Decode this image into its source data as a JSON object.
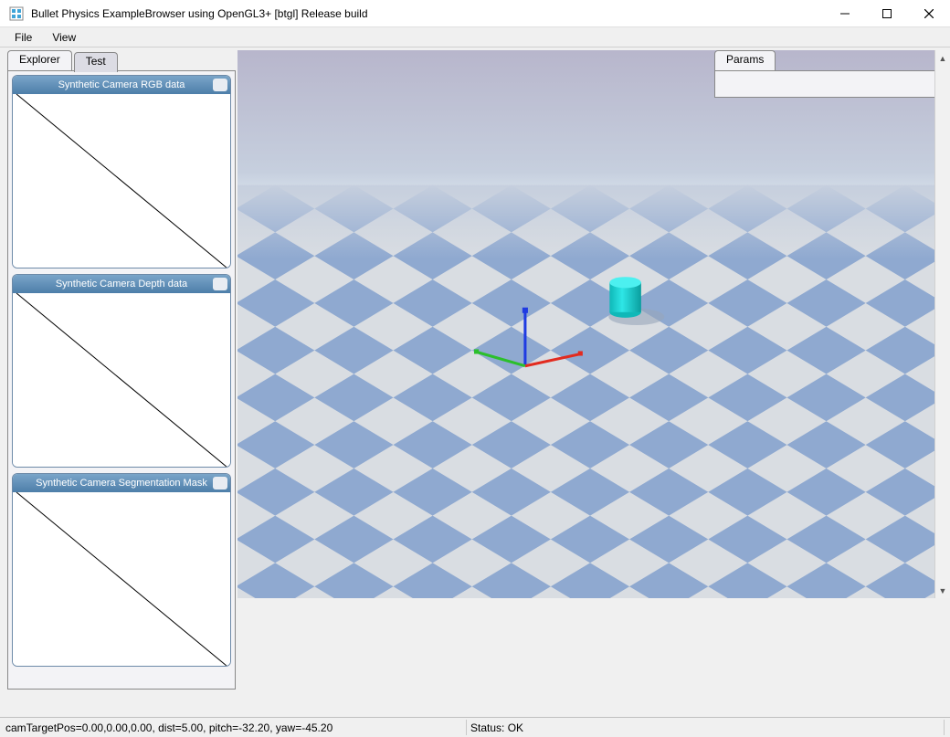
{
  "window": {
    "title": "Bullet Physics ExampleBrowser using OpenGL3+ [btgl] Release build"
  },
  "menu": {
    "file": "File",
    "view": "View"
  },
  "left": {
    "tabs": {
      "explorer": "Explorer",
      "test": "Test"
    },
    "cards": {
      "rgb": "Synthetic Camera RGB data",
      "depth": "Synthetic Camera Depth data",
      "seg": "Synthetic Camera Segmentation Mask"
    }
  },
  "right": {
    "tab": "Params"
  },
  "status": {
    "cam": "camTargetPos=0.00,0.00,0.00, dist=5.00, pitch=-32.20, yaw=-45.20",
    "ok": "Status: OK"
  },
  "scene": {
    "object": "cyan-cylinder",
    "axes": [
      "x-red",
      "y-green",
      "z-blue"
    ],
    "floor": "checkerboard-blue-gray"
  },
  "colors": {
    "floor_a": "#8fa9d0",
    "floor_b": "#d9dde2",
    "sky": "#b7b5cb",
    "haze": "#d6e0eb",
    "axis_x": "#e22b1f",
    "axis_y": "#2bbf2b",
    "axis_z": "#1f3be2",
    "cylinder": "#19d4d4",
    "cylinder_shadow": "#b1becf"
  }
}
